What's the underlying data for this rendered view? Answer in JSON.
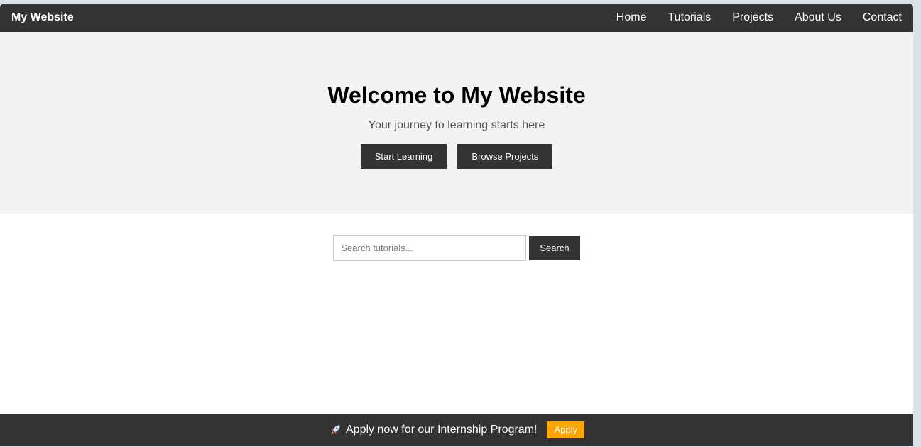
{
  "navbar": {
    "brand": "My Website",
    "links": [
      "Home",
      "Tutorials",
      "Projects",
      "About Us",
      "Contact"
    ]
  },
  "hero": {
    "title": "Welcome to My Website",
    "subtitle": "Your journey to learning starts here",
    "primary_button": "Start Learning",
    "secondary_button": "Browse Projects"
  },
  "search": {
    "placeholder": "Search tutorials...",
    "value": "",
    "button": "Search"
  },
  "banner": {
    "icon": "rocket-icon",
    "text": "Apply now for our Internship Program!",
    "button": "Apply",
    "button_color": "#ffa500"
  },
  "colors": {
    "dark": "#333333",
    "hero_bg": "#f3f3f3",
    "accent": "#ffa500"
  }
}
